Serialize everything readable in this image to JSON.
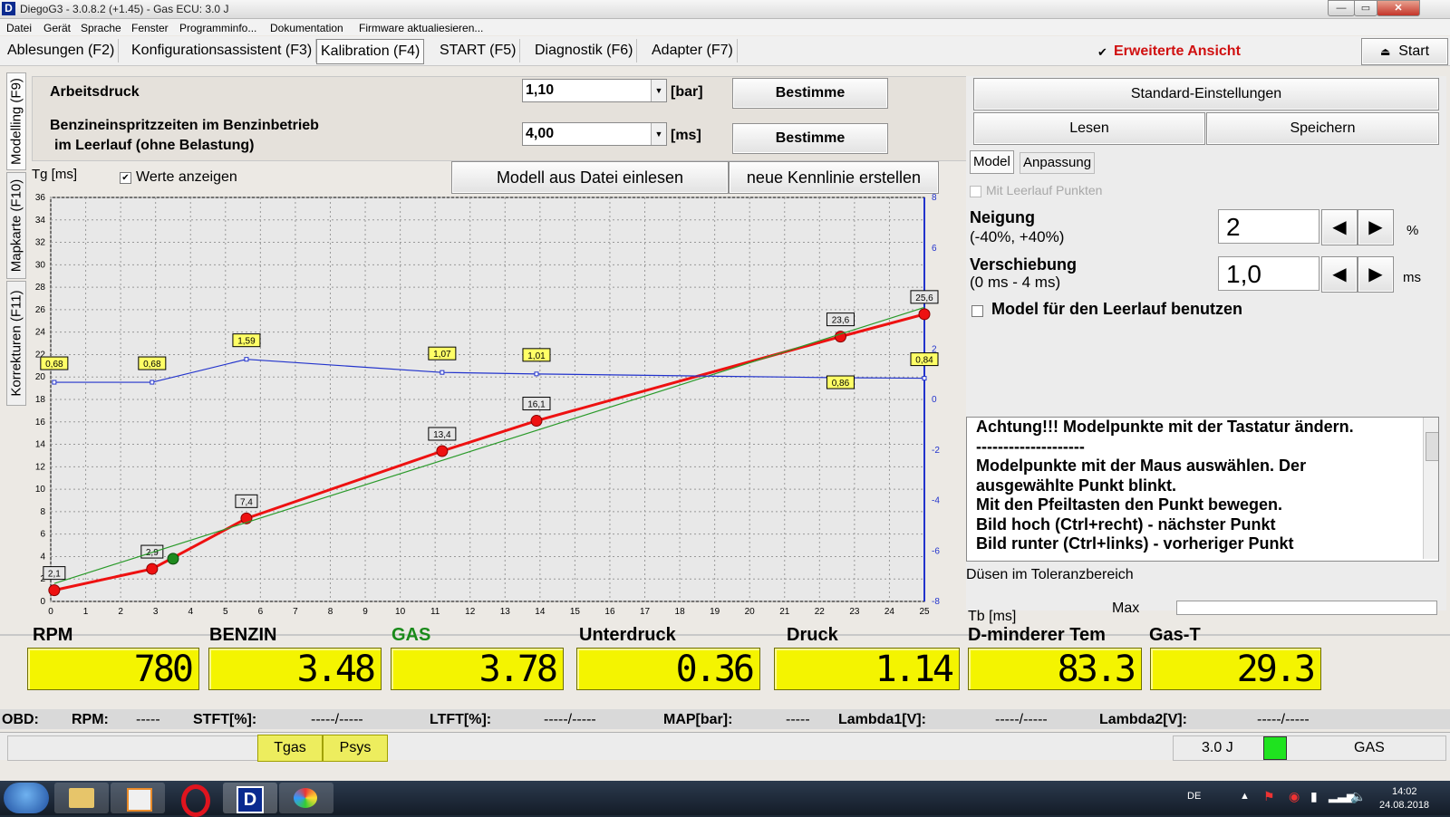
{
  "window": {
    "title": "DiegoG3 - 3.0.8.2 (+1.45) - Gas ECU: 3.0 J",
    "app_icon": "D",
    "controls": [
      "minimize-icon",
      "restore-icon",
      "close-icon"
    ]
  },
  "menu": [
    "Datei",
    "Gerät",
    "Sprache",
    "Fenster",
    "Programminfo...",
    "Dokumentation",
    "Firmware aktualiesieren..."
  ],
  "tabs": [
    "Ablesungen (F2)",
    "Konfigurationsassistent (F3)",
    "Kalibration (F4)",
    "START (F5)",
    "Diagnostik (F6)",
    "Adapter (F7)"
  ],
  "active_tab": "Kalibration (F4)",
  "extended_view": {
    "label": "Erweiterte Ansicht",
    "checked": "✔"
  },
  "start_button": {
    "label": "Start",
    "icon": "eject-icon"
  },
  "side_tabs": [
    "Modelling (F9)",
    "Mapkarte (F10)",
    "Korrekturen (F11)"
  ],
  "settings": {
    "pressure_label": "Arbeitsdruck",
    "pressure_value": "1,10",
    "pressure_unit": "[bar]",
    "injection_label_1": "Benzineinspritzzeiten im Benzinbetrieb",
    "injection_label_2": "im Leerlauf (ohne Belastung)",
    "injection_value": "4,00",
    "injection_unit": "[ms]",
    "determine_label": "Bestimme"
  },
  "chart_header": {
    "ylabel": "Tg [ms]",
    "show_values_label": "Werte anzeigen",
    "show_values_checked": "✔",
    "load_model_label": "Modell aus Datei einlesen",
    "new_curve_label": "neue Kennlinie erstellen"
  },
  "chart_data": {
    "type": "line",
    "ylabel": "Tg [ms]",
    "xlim": [
      0,
      25
    ],
    "ylim_left": [
      0,
      36
    ],
    "ylim_right": [
      -8,
      8
    ],
    "x_ticks": [
      "0",
      "1",
      "2",
      "3",
      "4",
      "5",
      "6",
      "7",
      "8",
      "9",
      "10",
      "11",
      "12",
      "13",
      "14",
      "15",
      "16",
      "17",
      "18",
      "19",
      "20",
      "21",
      "22",
      "23",
      "24",
      "25"
    ],
    "y_ticks_left": [
      "0",
      "2",
      "4",
      "6",
      "8",
      "10",
      "12",
      "14",
      "16",
      "18",
      "20",
      "22",
      "24",
      "26",
      "28",
      "30",
      "32",
      "34",
      "36"
    ],
    "y_ticks_right": [
      "-8",
      "-6",
      "-4",
      "-2",
      "0",
      "2",
      "4",
      "6",
      "8"
    ],
    "grid": true,
    "series": [
      {
        "color": "#ee1111",
        "points": [
          [
            0.1,
            1.0
          ],
          [
            2.9,
            2.9
          ],
          [
            5.6,
            7.4
          ],
          [
            11.2,
            13.4
          ],
          [
            13.9,
            16.1
          ],
          [
            22.6,
            23.6
          ],
          [
            25,
            25.6
          ]
        ],
        "labels": [
          "2,1",
          "2,9",
          "7,4",
          "13,4",
          "16,1",
          "23,6",
          "25,6"
        ]
      },
      {
        "color": "#2a9a2a",
        "points": [
          [
            0.1,
            1.6
          ],
          [
            25,
            26.2
          ]
        ]
      },
      {
        "axis": "right",
        "color": "#2233cc",
        "points": [
          [
            0.1,
            0.68
          ],
          [
            2.9,
            0.68
          ],
          [
            5.6,
            1.59
          ],
          [
            11.2,
            1.07
          ],
          [
            13.9,
            1.01
          ],
          [
            22.6,
            0.86
          ],
          [
            25,
            0.84
          ]
        ],
        "labels": [
          "0,68",
          "0,68",
          "1,59",
          "1,07",
          "1,01",
          "0,86",
          "0,84"
        ]
      }
    ],
    "marker": {
      "x": 3.5,
      "y": 3.8,
      "color": "#1f8a1f"
    }
  },
  "right_panel": {
    "standard_label": "Standard-Einstellungen",
    "read_label": "Lesen",
    "save_label": "Speichern",
    "subtabs": [
      "Model",
      "Anpassung"
    ],
    "idle_points_label": "Mit Leerlauf Punkten",
    "slope_label": "Neigung",
    "slope_range": "(-40%, +40%)",
    "slope_value": "2",
    "slope_unit": "%",
    "shift_label": "Verschiebung",
    "shift_range": "(0 ms - 4 ms)",
    "shift_value": "1,0",
    "shift_unit": "ms",
    "idle_model_label": "Model für den Leerlauf benutzen",
    "info_lines": [
      "Achtung!!! Modelpunkte mit der Tastatur ändern.",
      "--------------------",
      "Modelpunkte mit der Maus auswählen. Der",
      "ausgewählte Punkt blinkt.",
      "Mit den Pfeiltasten den Punkt bewegen.",
      "Bild hoch (Ctrl+recht) - nächster Punkt",
      "Bild runter (Ctrl+links) - vorheriger Punkt"
    ],
    "injectors_label": "Düsen im Toleranzbereich",
    "tb_label": "Tb [ms]",
    "max_label": "Max"
  },
  "gauges": [
    {
      "label": "RPM",
      "value": "780",
      "label_color": "#000000"
    },
    {
      "label": "BENZIN",
      "value": "3.48",
      "label_color": "#000000"
    },
    {
      "label": "GAS",
      "value": "3.78",
      "label_color": "#1a8a1a"
    },
    {
      "label": "Unterdruck",
      "value": "0.36",
      "label_color": "#000000"
    },
    {
      "label": "Druck",
      "value": "1.14",
      "label_color": "#000000"
    },
    {
      "label": "D-minderer Tem",
      "value": "83.3",
      "label_color": "#000000"
    },
    {
      "label": "Gas-T",
      "value": "29.3",
      "label_color": "#000000"
    }
  ],
  "obd": {
    "obd": "OBD:",
    "rpm": "RPM:",
    "rpm_val": "-----",
    "stft": "STFT[%]:",
    "stft_val": "-----/-----",
    "ltft": "LTFT[%]:",
    "ltft_val": "-----/-----",
    "map": "MAP[bar]:",
    "map_val": "-----",
    "lambda1": "Lambda1[V]:",
    "lambda1_val": "-----/-----",
    "lambda2": "Lambda2[V]:",
    "lambda2_val": "-----/-----"
  },
  "bottom": {
    "tgas": "Tgas",
    "psys": "Psys",
    "version": "3.0 J",
    "fuel": "GAS"
  },
  "taskbar": {
    "lang": "DE",
    "time": "14:02",
    "date": "24.08.2018",
    "apps": [
      "start-orb-icon",
      "explorer-icon",
      "media-player-icon",
      "opera-icon",
      "diego-icon",
      "paint-icon"
    ]
  }
}
